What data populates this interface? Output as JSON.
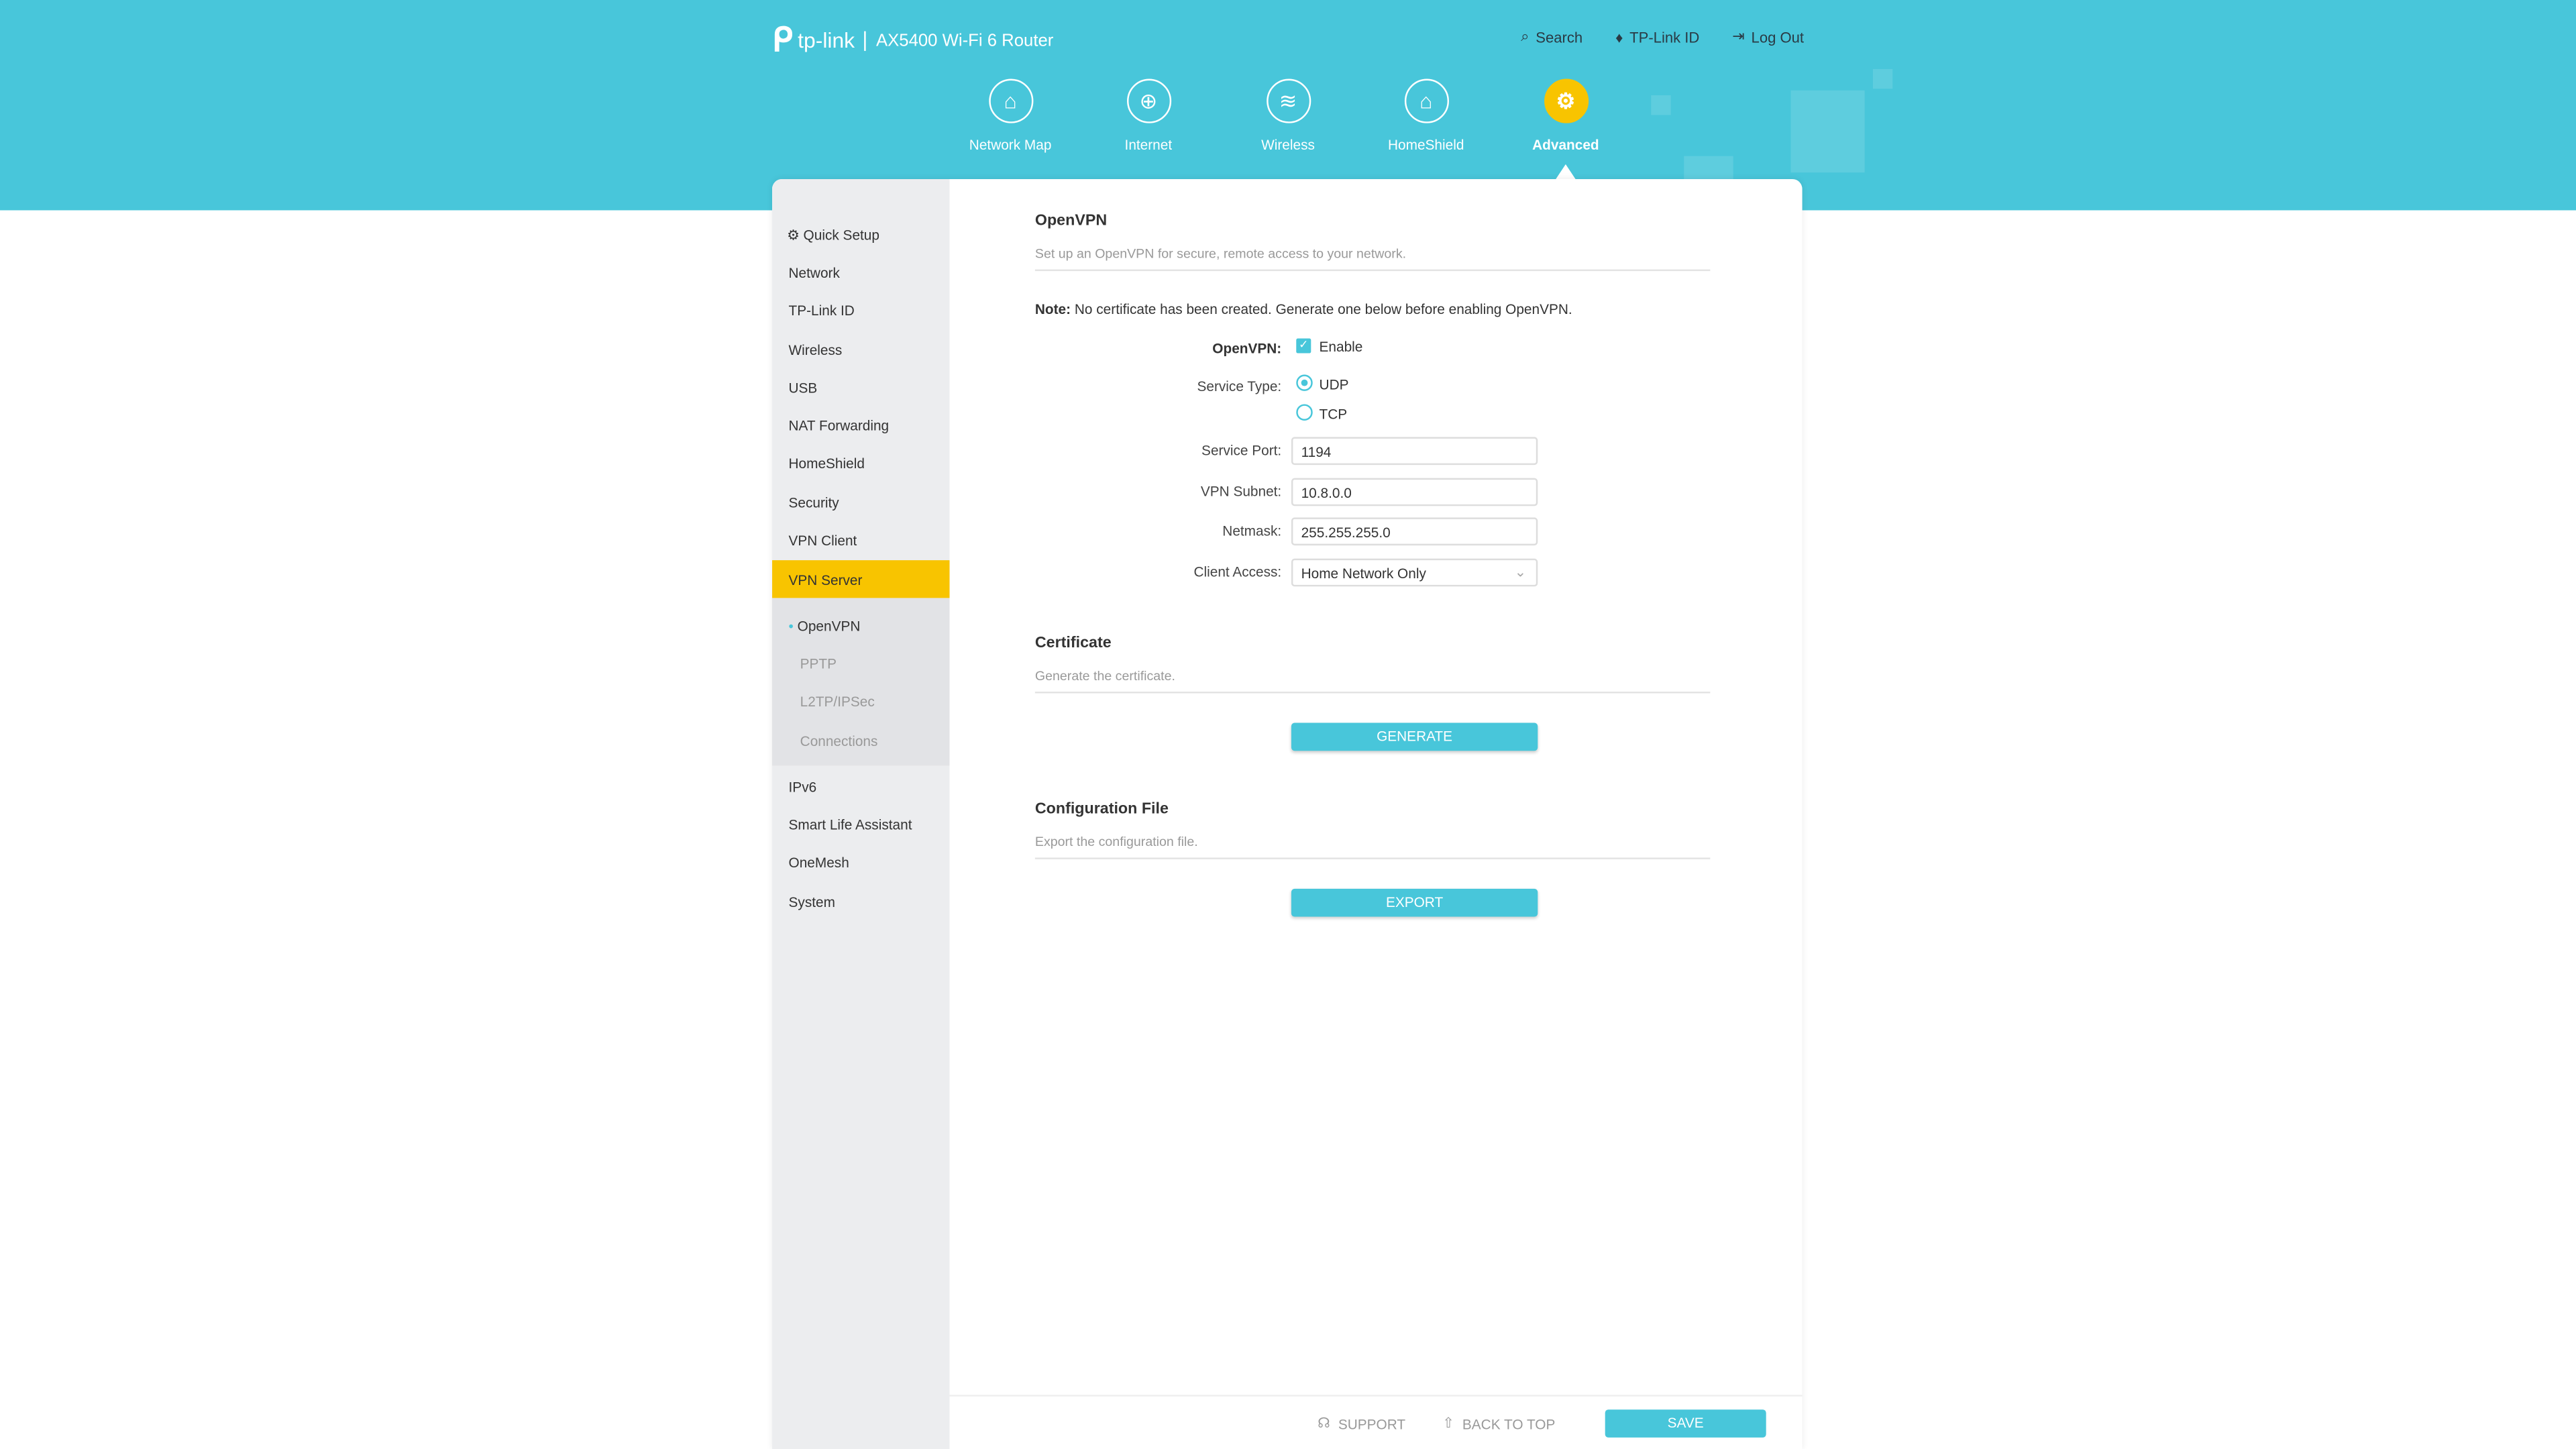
{
  "header": {
    "brand": "tp-link",
    "model": "AX5400 Wi-Fi 6 Router",
    "links": [
      {
        "label": "Search",
        "icon": "search-icon"
      },
      {
        "label": "TP-Link ID",
        "icon": "user-icon"
      },
      {
        "label": "Log Out",
        "icon": "logout-icon"
      }
    ]
  },
  "nav": [
    {
      "label": "Network Map",
      "icon": "network-map-icon"
    },
    {
      "label": "Internet",
      "icon": "globe-icon"
    },
    {
      "label": "Wireless",
      "icon": "wifi-icon"
    },
    {
      "label": "HomeShield",
      "icon": "home-shield-icon"
    },
    {
      "label": "Advanced",
      "icon": "gear-icon",
      "active": true
    }
  ],
  "sidebar": {
    "items": [
      "Quick Setup",
      "Network",
      "TP-Link ID",
      "Wireless",
      "USB",
      "NAT Forwarding",
      "HomeShield",
      "Security",
      "VPN Client",
      "VPN Server"
    ],
    "sub": [
      "OpenVPN",
      "PPTP",
      "L2TP/IPSec",
      "Connections"
    ],
    "after": [
      "IPv6",
      "Smart Life Assistant",
      "OneMesh",
      "System"
    ]
  },
  "openvpn": {
    "title": "OpenVPN",
    "desc": "Set up an OpenVPN for secure, remote access to your network.",
    "note_label": "Note:",
    "note": " No certificate has been created. Generate one below before enabling OpenVPN.",
    "enable_label": "OpenVPN:",
    "enable_text": "Enable",
    "enabled": true,
    "service_type_label": "Service Type:",
    "service_types": [
      "UDP",
      "TCP"
    ],
    "service_type": "UDP",
    "port_label": "Service Port:",
    "port": "1194",
    "subnet_label": "VPN Subnet:",
    "subnet": "10.8.0.0",
    "netmask_label": "Netmask:",
    "netmask": "255.255.255.0",
    "access_label": "Client Access:",
    "access": "Home Network Only"
  },
  "certificate": {
    "title": "Certificate",
    "desc": "Generate the certificate.",
    "button": "GENERATE"
  },
  "config": {
    "title": "Configuration File",
    "desc": "Export the configuration file.",
    "button": "EXPORT"
  },
  "footer": {
    "support": "SUPPORT",
    "back_to_top": "BACK TO TOP",
    "save": "SAVE"
  },
  "colors": {
    "accent": "#48c6da",
    "active": "#f8c400"
  }
}
